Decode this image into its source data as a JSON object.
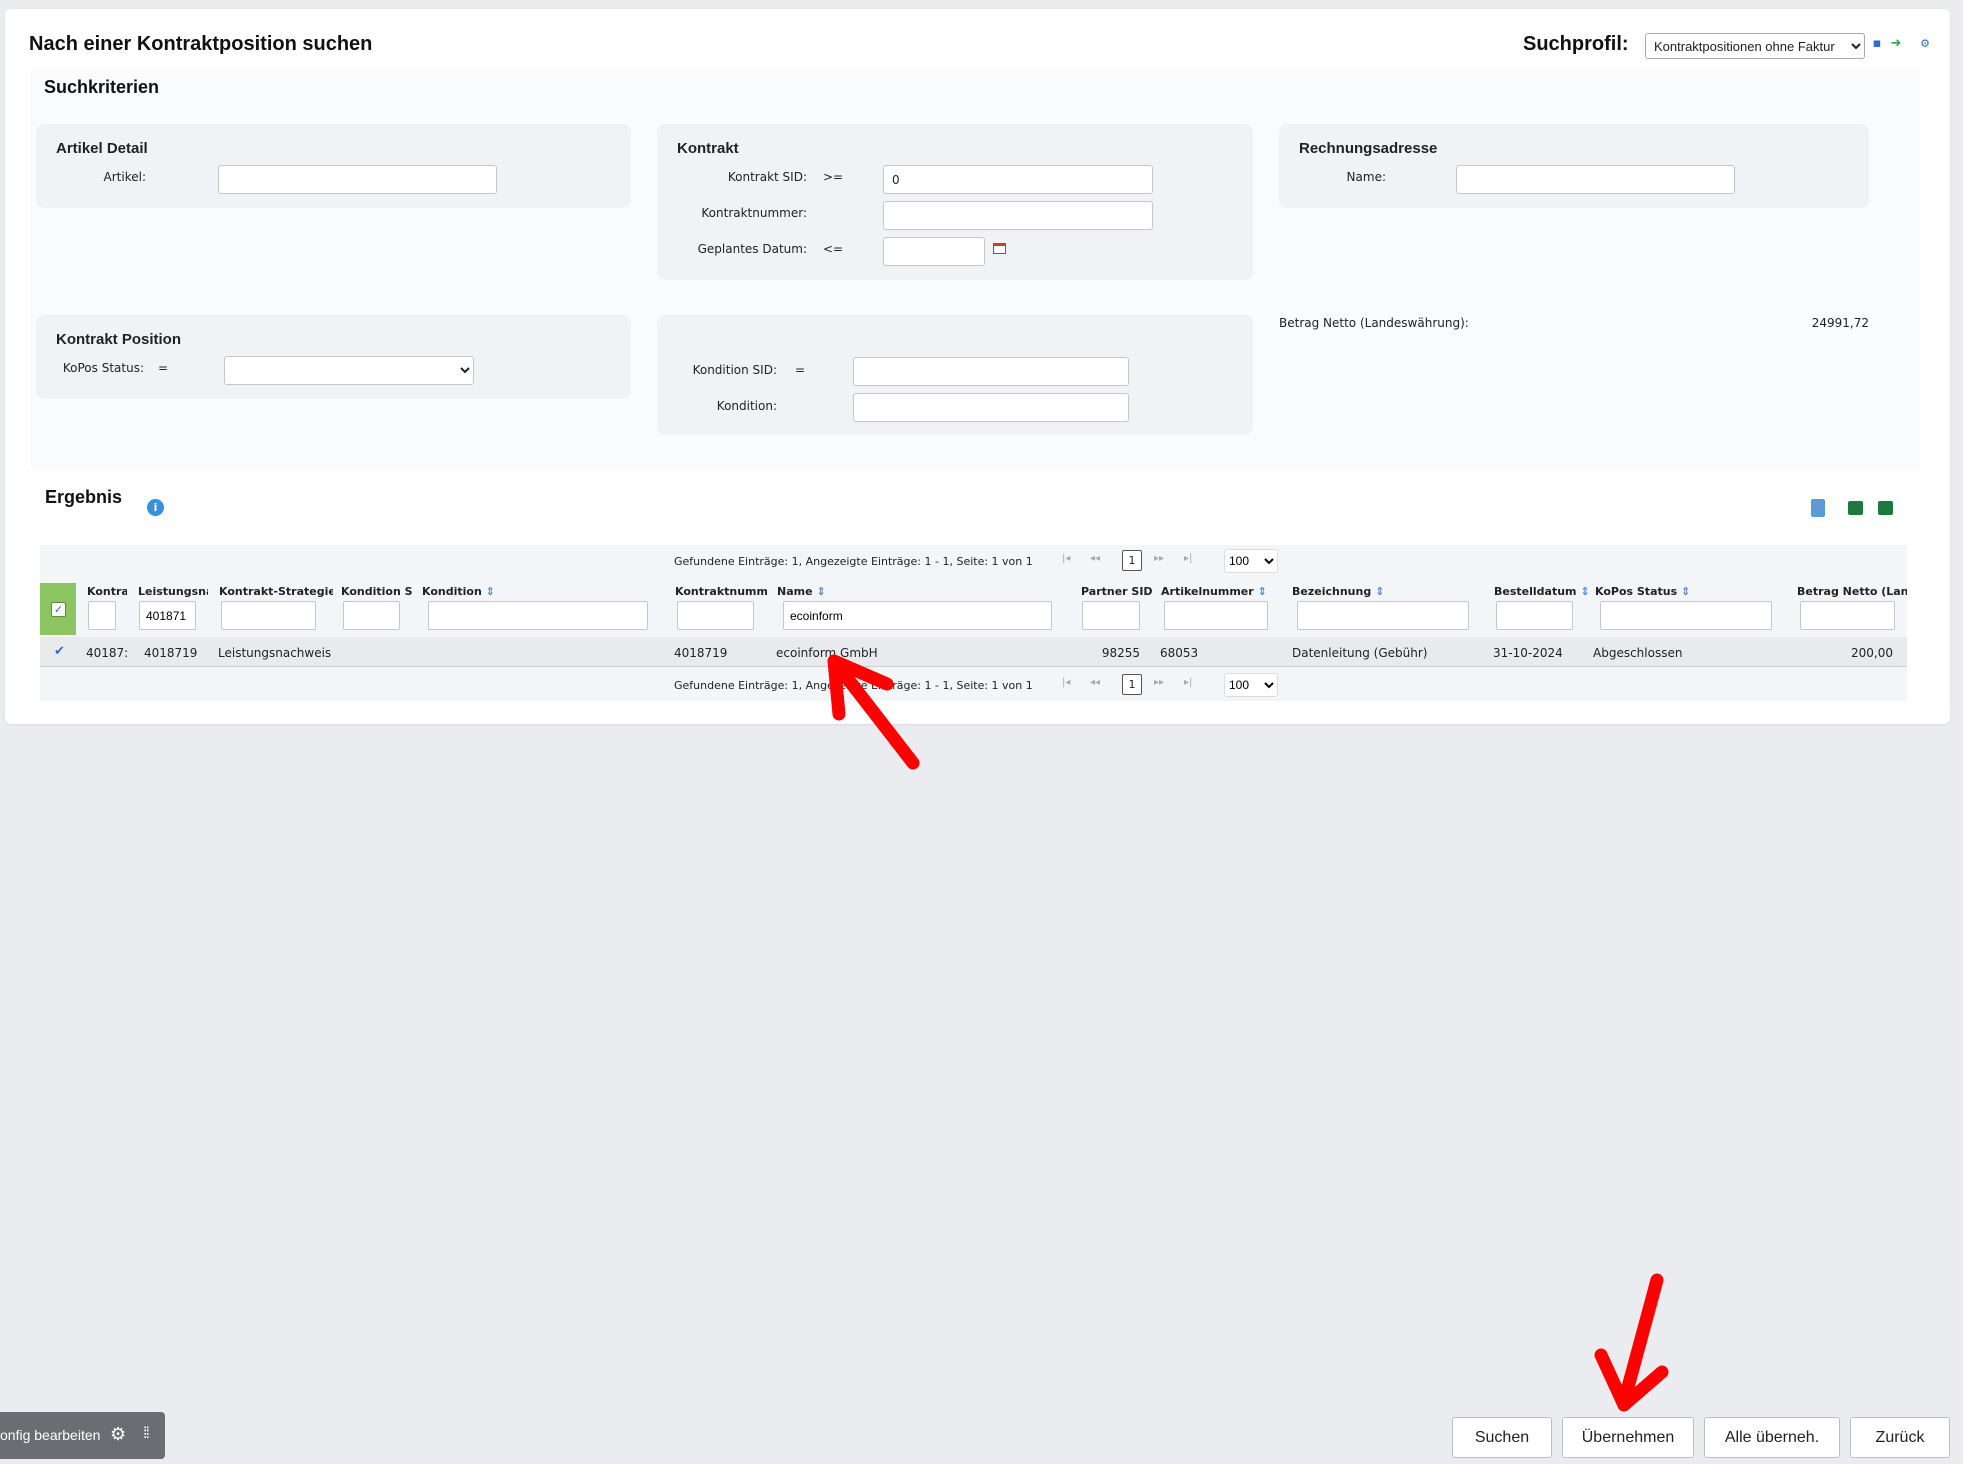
{
  "header": {
    "title": "Nach einer Kontraktposition suchen",
    "profile_label": "Suchprofil:",
    "profile_value": "Kontraktpositionen ohne Faktur"
  },
  "criteria": {
    "title": "Suchkriterien",
    "artikel_detail": {
      "title": "Artikel Detail",
      "artikel_label": "Artikel:",
      "artikel_value": ""
    },
    "kontrakt": {
      "title": "Kontrakt",
      "sid_label": "Kontrakt SID:",
      "sid_op": ">=",
      "sid_value": "0",
      "nummer_label": "Kontraktnummer:",
      "nummer_value": "",
      "datum_label": "Geplantes Datum:",
      "datum_op": "<=",
      "datum_value": ""
    },
    "rechnungsadresse": {
      "title": "Rechnungsadresse",
      "name_label": "Name:",
      "name_value": ""
    },
    "kontrakt_position": {
      "title": "Kontrakt Position",
      "status_label": "KoPos Status:",
      "status_op": "=",
      "status_value": ""
    },
    "kondition": {
      "sid_label": "Kondition SID:",
      "sid_op": "=",
      "sid_value": "",
      "kond_label": "Kondition:",
      "kond_value": ""
    },
    "betrag_label": "Betrag Netto (Landeswährung):",
    "betrag_value": "24991,72"
  },
  "result": {
    "title": "Ergebnis",
    "pager": {
      "text": "Gefundene Einträge: 1, Angezeigte Einträge: 1 - 1, Seite: 1 von 1",
      "page": "1",
      "page_size": "100"
    },
    "columns": [
      {
        "label": "Kontra",
        "filter": ""
      },
      {
        "label": "Leistungsna",
        "filter": "401871"
      },
      {
        "label": "Kontrakt-Strategie",
        "filter": ""
      },
      {
        "label": "Kondition S",
        "filter": ""
      },
      {
        "label": "Kondition",
        "filter": ""
      },
      {
        "label": "Kontraktnumm",
        "filter": ""
      },
      {
        "label": "Name",
        "filter": "ecoinform"
      },
      {
        "label": "Partner SID",
        "filter": ""
      },
      {
        "label": "Artikelnummer",
        "filter": ""
      },
      {
        "label": "Bezeichnung",
        "filter": ""
      },
      {
        "label": "Bestelldatum",
        "filter": ""
      },
      {
        "label": "KoPos Status",
        "filter": ""
      },
      {
        "label": "Betrag Netto (Lan",
        "filter": ""
      }
    ],
    "row": {
      "kontra": "40187:",
      "leistung": "4018719",
      "strategie": "Leistungsnachweis",
      "kond_s": "",
      "kondition": "",
      "kontraktnummer": "4018719",
      "name": "ecoinform GmbH",
      "partner_sid": "98255",
      "artikelnummer": "68053",
      "bezeichnung": "Datenleitung (Gebühr)",
      "bestelldatum": "31-10-2024",
      "status": "Abgeschlossen",
      "betrag": "200,00"
    }
  },
  "footer": {
    "config_label": "onfig bearbeiten",
    "buttons": {
      "suchen": "Suchen",
      "uebernehmen": "Übernehmen",
      "alle": "Alle überneh.",
      "zurueck": "Zurück"
    }
  },
  "colors": {
    "accent_green": "#8dc462",
    "link_blue": "#2a6fd0",
    "annotation_red": "#ff0000"
  }
}
